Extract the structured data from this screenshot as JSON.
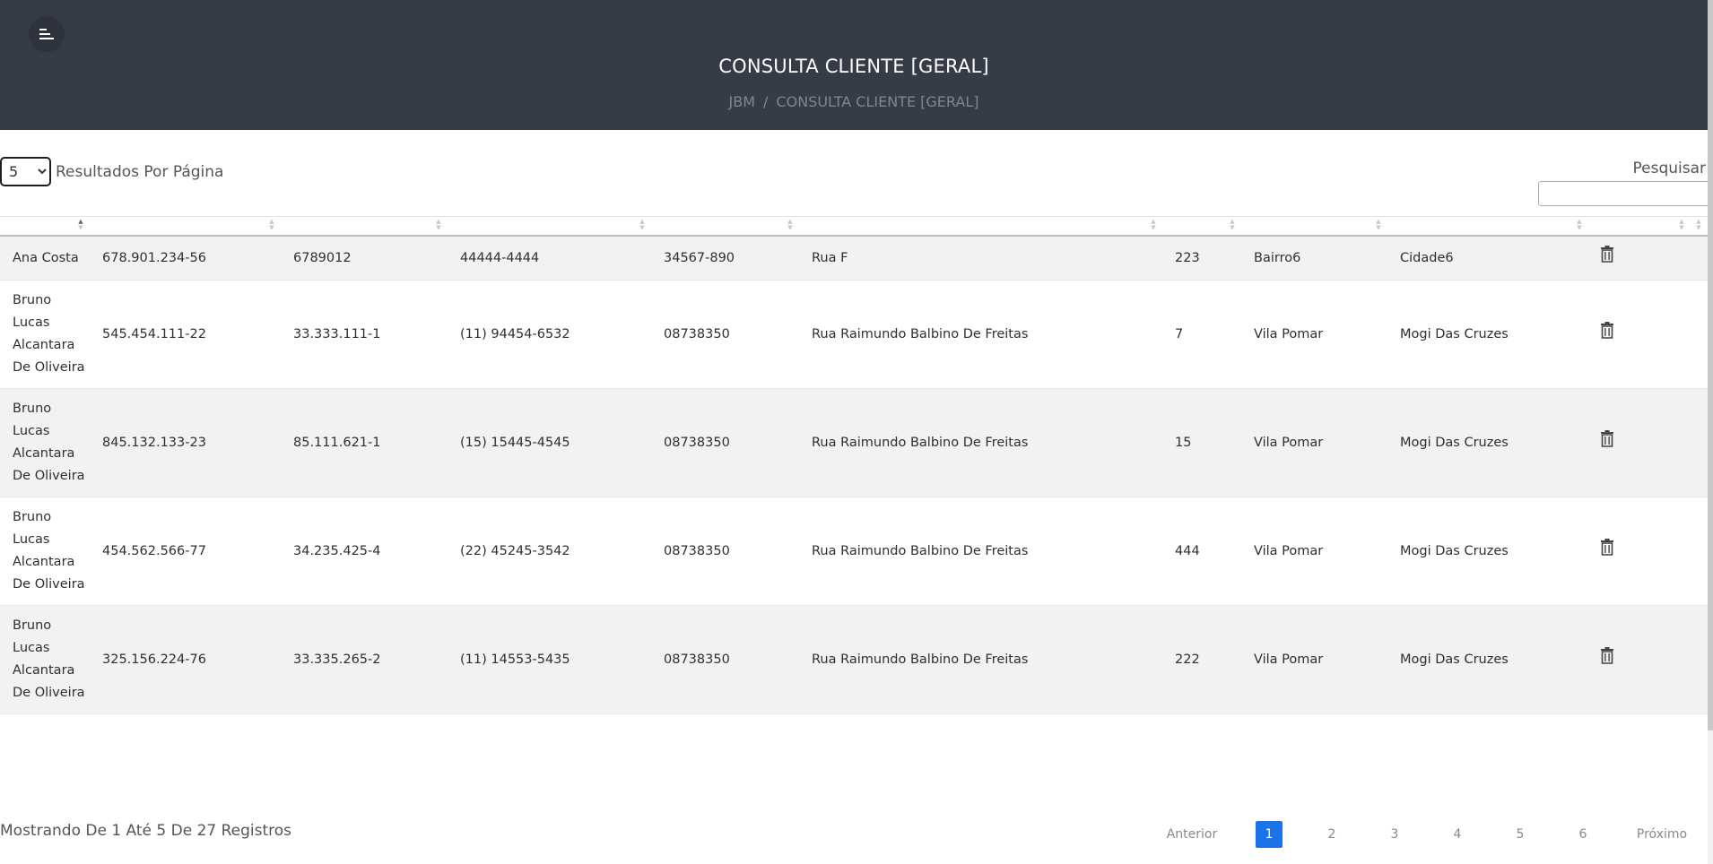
{
  "header": {
    "title": "CONSULTA CLIENTE [GERAL]",
    "breadcrumb": {
      "home": "JBM",
      "separator": "/",
      "current": "CONSULTA CLIENTE [GERAL]"
    }
  },
  "controls": {
    "results_per_page_value": "5",
    "results_per_page_label": "Resultados Por Página",
    "search_label": "Pesquisar",
    "search_value": ""
  },
  "table": {
    "columns": [
      "",
      "",
      "",
      "",
      "",
      "",
      "",
      "",
      "",
      "",
      ""
    ],
    "sorted_column": 0,
    "rows": [
      {
        "nome": "Ana Costa",
        "cpf": "678.901.234-56",
        "rg": "6789012",
        "telefone": "44444-4444",
        "cep": "34567-890",
        "rua": "Rua F",
        "numero": "223",
        "bairro": "Bairro6",
        "cidade": "Cidade6"
      },
      {
        "nome": "Bruno Lucas Alcantara De Oliveira",
        "cpf": "545.454.111-22",
        "rg": "33.333.111-1",
        "telefone": "(11) 94454-6532",
        "cep": "08738350",
        "rua": "Rua Raimundo Balbino De Freitas",
        "numero": "7",
        "bairro": "Vila Pomar",
        "cidade": "Mogi Das Cruzes"
      },
      {
        "nome": "Bruno Lucas Alcantara De Oliveira",
        "cpf": "845.132.133-23",
        "rg": "85.111.621-1",
        "telefone": "(15) 15445-4545",
        "cep": "08738350",
        "rua": "Rua Raimundo Balbino De Freitas",
        "numero": "15",
        "bairro": "Vila Pomar",
        "cidade": "Mogi Das Cruzes"
      },
      {
        "nome": "Bruno Lucas Alcantara De Oliveira",
        "cpf": "454.562.566-77",
        "rg": "34.235.425-4",
        "telefone": "(22) 45245-3542",
        "cep": "08738350",
        "rua": "Rua Raimundo Balbino De Freitas",
        "numero": "444",
        "bairro": "Vila Pomar",
        "cidade": "Mogi Das Cruzes"
      },
      {
        "nome": "Bruno Lucas Alcantara De Oliveira",
        "cpf": "325.156.224-76",
        "rg": "33.335.265-2",
        "telefone": "(11) 14553-5435",
        "cep": "08738350",
        "rua": "Rua Raimundo Balbino De Freitas",
        "numero": "222",
        "bairro": "Vila Pomar",
        "cidade": "Mogi Das Cruzes"
      }
    ]
  },
  "footer": {
    "info": "Mostrando De 1 Até 5 De 27 Registros",
    "previous": "Anterior",
    "next": "Próximo",
    "pages": [
      "1",
      "2",
      "3",
      "4",
      "5",
      "6"
    ],
    "active_page": "1"
  },
  "icons": {
    "menu": "menu-icon",
    "delete": "trash-icon",
    "sort": "sort-icon"
  },
  "colors": {
    "header_bg": "#363b48",
    "accent": "#1a73e8",
    "row_alt": "#f2f2f2"
  }
}
